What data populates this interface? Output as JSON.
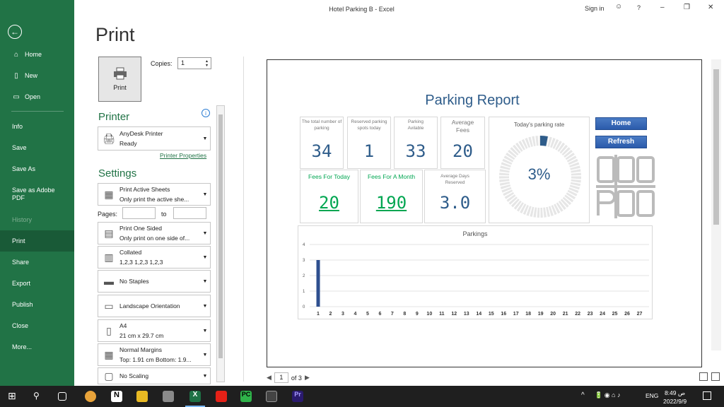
{
  "window": {
    "title": "Hotel Parking B  -  Excel",
    "sign_in": "Sign in",
    "help": "?",
    "minimize": "–",
    "restore": "❐",
    "close": "✕"
  },
  "sidebar": {
    "items": [
      {
        "label": "Home",
        "icon": "⌂"
      },
      {
        "label": "New",
        "icon": "🗋"
      },
      {
        "label": "Open",
        "icon": "🗁"
      },
      {
        "label": "Info"
      },
      {
        "label": "Save"
      },
      {
        "label": "Save As"
      },
      {
        "label": "Save as Adobe PDF"
      },
      {
        "label": "History"
      },
      {
        "label": "Print"
      },
      {
        "label": "Share"
      },
      {
        "label": "Export"
      },
      {
        "label": "Publish"
      },
      {
        "label": "Close"
      },
      {
        "label": "More..."
      }
    ]
  },
  "print": {
    "heading": "Print",
    "button_label": "Print",
    "copies_label": "Copies:",
    "copies_value": "1",
    "printer_heading": "Printer",
    "printer_name": "AnyDesk Printer",
    "printer_status": "Ready",
    "printer_properties": "Printer Properties",
    "settings_heading": "Settings",
    "settings": [
      {
        "line1": "Print Active Sheets",
        "line2": "Only print the active she..."
      },
      {
        "line1": "Print One Sided",
        "line2": "Only print on one side of..."
      },
      {
        "line1": "Collated",
        "line2": "1,2,3    1,2,3    1,2,3"
      },
      {
        "line1": "No Staples",
        "line2": ""
      },
      {
        "line1": "Landscape Orientation",
        "line2": ""
      },
      {
        "line1": "A4",
        "line2": "21 cm x 29.7 cm"
      },
      {
        "line1": "Normal Margins",
        "line2": "Top: 1.91 cm Bottom: 1.9..."
      },
      {
        "line1": "No Scaling",
        "line2": ""
      }
    ],
    "pages_label": "Pages:",
    "to_label": "to"
  },
  "report": {
    "title": "Parking Report",
    "cards": [
      {
        "label": "The total number of parking",
        "value": "34"
      },
      {
        "label": "Reserved parking spots today",
        "value": "1"
      },
      {
        "label": "Parking Avilable",
        "value": "33"
      },
      {
        "label": "Average Fees",
        "value": "20"
      },
      {
        "label": "Fees For Today",
        "value": "20"
      },
      {
        "label": "Fees For A Month",
        "value": "190"
      },
      {
        "label": "Average Days Reserved",
        "value": "3.0"
      }
    ],
    "rate_label": "Today's parking rate",
    "rate_value": "3%",
    "rate_fraction": 0.03,
    "buttons": {
      "home": "Home",
      "refresh": "Refresh"
    },
    "colors": {
      "accent": "#2e5c8a",
      "green": "#00a651",
      "excel": "#217346"
    }
  },
  "chart_data": {
    "type": "bar",
    "title": "Parkings",
    "categories": [
      "1",
      "2",
      "3",
      "4",
      "5",
      "6",
      "7",
      "8",
      "9",
      "10",
      "11",
      "12",
      "13",
      "14",
      "15",
      "16",
      "17",
      "18",
      "19",
      "20",
      "21",
      "22",
      "23",
      "24",
      "25",
      "26",
      "27"
    ],
    "values": [
      3,
      0,
      0,
      0,
      0,
      0,
      0,
      0,
      0,
      0,
      0,
      0,
      0,
      0,
      0,
      0,
      0,
      0,
      0,
      0,
      0,
      0,
      0,
      0,
      0,
      0,
      0
    ],
    "ylim": [
      0,
      4
    ],
    "yticks": [
      "0",
      "1",
      "2",
      "3",
      "4"
    ],
    "grid": true
  },
  "page_nav": {
    "current": "1",
    "of": "of 3"
  },
  "taskbar": {
    "time": "8:49 ص",
    "date": "2022/9/9",
    "lang": "ENG"
  }
}
